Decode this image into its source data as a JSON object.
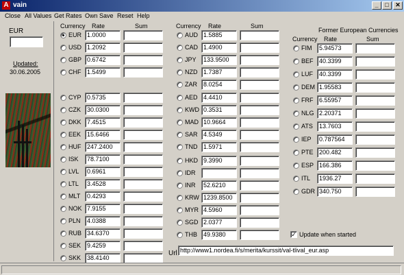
{
  "window": {
    "title": "vain",
    "icon_letter": "A",
    "minimize": "_",
    "maximize": "□",
    "close": "✕"
  },
  "menu": [
    "Close",
    "All Values",
    "Get Rates",
    "Own Save",
    "Reset",
    "Help"
  ],
  "left": {
    "base_currency": "EUR",
    "base_input": "",
    "updated_label": "Updated:",
    "updated_date": "30.06.2005"
  },
  "headers": {
    "currency": "Currency",
    "rate": "Rate",
    "sum": "Sum",
    "former_title": "Former European Currencies"
  },
  "col1": [
    {
      "code": "EUR",
      "rate": "1.0000",
      "checked": true
    },
    {
      "code": "USD",
      "rate": "1.2092"
    },
    {
      "code": "GBP",
      "rate": "0.6742"
    },
    {
      "code": "CHF",
      "rate": "1.5499"
    },
    {
      "code": "CYP",
      "rate": "0.5735"
    },
    {
      "code": "CZK",
      "rate": "30.0300"
    },
    {
      "code": "DKK",
      "rate": "7.4515"
    },
    {
      "code": "EEK",
      "rate": "15.6466"
    },
    {
      "code": "HUF",
      "rate": "247.2400"
    },
    {
      "code": "ISK",
      "rate": "78.7100"
    },
    {
      "code": "LVL",
      "rate": "0.6961"
    },
    {
      "code": "LTL",
      "rate": "3.4528"
    },
    {
      "code": "MLT",
      "rate": "0.4293"
    },
    {
      "code": "NOK",
      "rate": "7.9155"
    },
    {
      "code": "PLN",
      "rate": "4.0388"
    },
    {
      "code": "RUB",
      "rate": "34.6370"
    },
    {
      "code": "SEK",
      "rate": "9.4259"
    },
    {
      "code": "SKK",
      "rate": "38.4140"
    }
  ],
  "col2": [
    {
      "code": "AUD",
      "rate": "1.5885"
    },
    {
      "code": "CAD",
      "rate": "1.4900"
    },
    {
      "code": "JPY",
      "rate": "133.9500"
    },
    {
      "code": "NZD",
      "rate": "1.7387"
    },
    {
      "code": "ZAR",
      "rate": "8.0254"
    },
    {
      "code": "AED",
      "rate": "4.4410"
    },
    {
      "code": "KWD",
      "rate": "0.3531"
    },
    {
      "code": "MAD",
      "rate": "10.9664"
    },
    {
      "code": "SAR",
      "rate": "4.5349"
    },
    {
      "code": "TND",
      "rate": "1.5971"
    },
    {
      "code": "HKD",
      "rate": "9.3990"
    },
    {
      "code": "IDR",
      "rate": ""
    },
    {
      "code": "INR",
      "rate": "52.6210"
    },
    {
      "code": "KRW",
      "rate": "1239.8500"
    },
    {
      "code": "MYR",
      "rate": "4.5960"
    },
    {
      "code": "SGD",
      "rate": "2.0377"
    },
    {
      "code": "THB",
      "rate": "49.9380"
    }
  ],
  "col3": [
    {
      "code": "FIM",
      "rate": "5.94573"
    },
    {
      "code": "BEF",
      "rate": "40.3399"
    },
    {
      "code": "LUF",
      "rate": "40.3399"
    },
    {
      "code": "DEM",
      "rate": "1.95583"
    },
    {
      "code": "FRF",
      "rate": "6.55957"
    },
    {
      "code": "NLG",
      "rate": "2.20371"
    },
    {
      "code": "ATS",
      "rate": "13.7603"
    },
    {
      "code": "IEP",
      "rate": "0.787564"
    },
    {
      "code": "PTE",
      "rate": "200.482"
    },
    {
      "code": "ESP",
      "rate": "166.386"
    },
    {
      "code": "ITL",
      "rate": "1936.27"
    },
    {
      "code": "GDR",
      "rate": "340.750"
    }
  ],
  "update_when_started": {
    "label": "Update when started",
    "checked": true,
    "check_mark": "✓"
  },
  "url": {
    "label": "Url",
    "value": "http://www1.nordea.fi/s/merita/kurssit/val-tlival_eur.asp"
  }
}
